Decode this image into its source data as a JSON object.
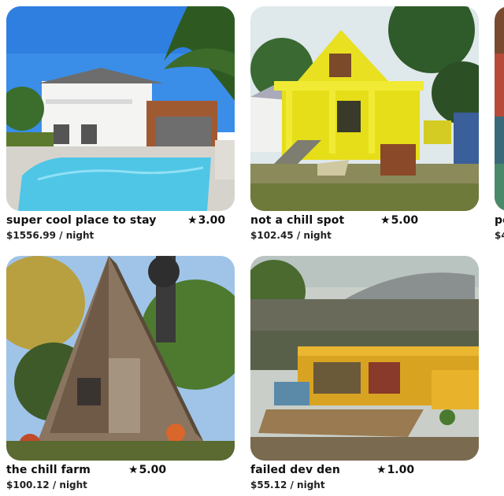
{
  "listings": [
    {
      "title": "super cool place to stay",
      "rating": "3.00",
      "price": "$1556.99 / night",
      "photo_icon": "house-pool-photo"
    },
    {
      "title": "not a chill spot",
      "rating": "5.00",
      "price": "$102.45 / night",
      "photo_icon": "yellow-house-photo"
    },
    {
      "title": "po",
      "rating": "",
      "price": "$4",
      "photo_icon": "partial-listing-photo"
    },
    {
      "title": "the chill farm",
      "rating": "5.00",
      "price": "$100.12 / night",
      "photo_icon": "a-frame-shack-photo"
    },
    {
      "title": "failed dev den",
      "rating": "1.00",
      "price": "$55.12 / night",
      "photo_icon": "bus-hideout-photo"
    }
  ],
  "star_symbol": "★",
  "colors": {
    "accent_yellow": "#e8e020",
    "pool_blue": "#4fc6e6"
  }
}
